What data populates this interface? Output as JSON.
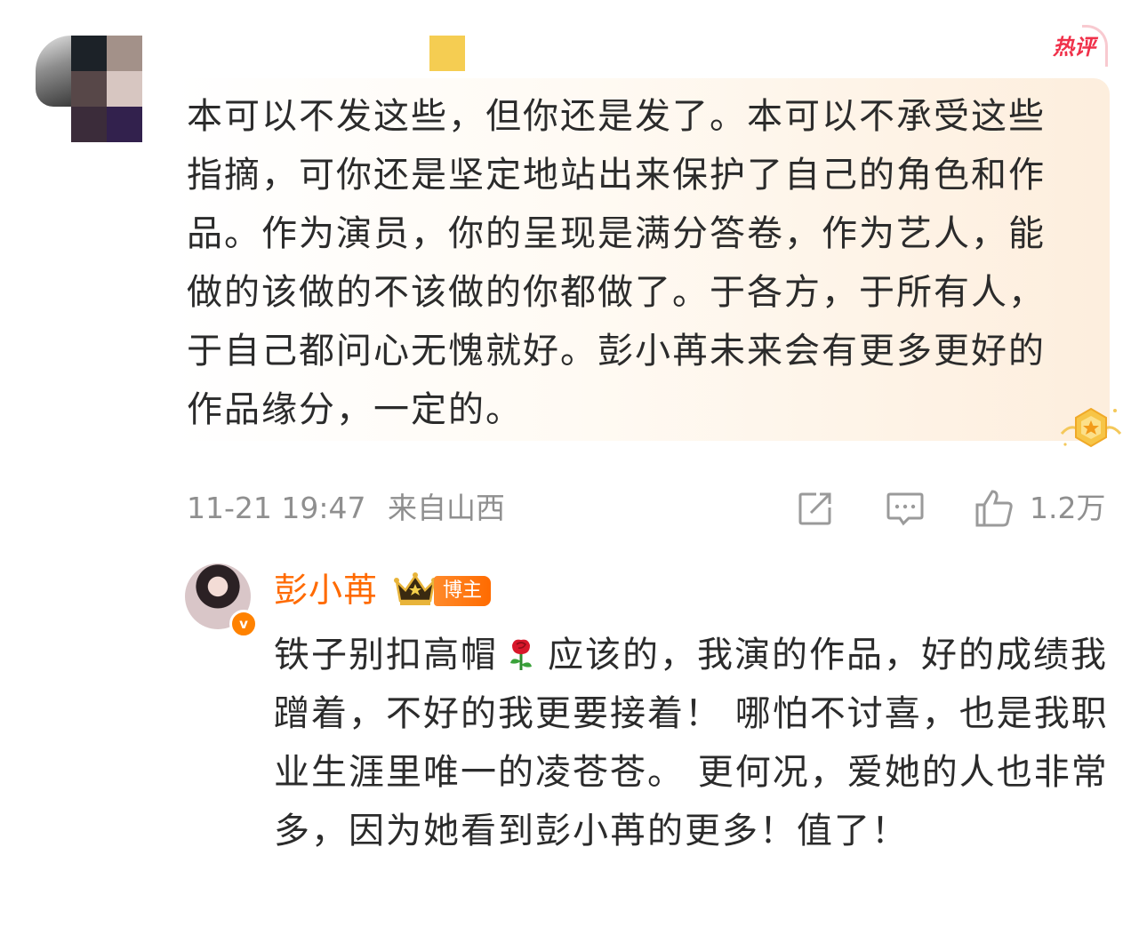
{
  "comment": {
    "hot_label": "热评",
    "text": "本可以不发这些，但你还是发了。本可以不承受这些指摘，可你还是坚定地站出来保护了自己的角色和作品。作为演员，你的呈现是满分答卷，作为艺人，能做的该做的不该做的你都做了。于各方，于所有人，于自己都问心无愧就好。彭小苒未来会有更多更好的作品缘分，一定的。",
    "timestamp": "11-21 19:47",
    "location": "来自山西",
    "like_count": "1.2万"
  },
  "reply": {
    "author": "彭小苒",
    "role_tag": "博主",
    "text_before_emoji": "铁子别扣高帽",
    "emoji": "rose-emoji",
    "text_after_emoji": "应该的，我演的作品，好的成绩我蹭着，不好的我更要接着！ 哪怕不讨喜，也是我职业生涯里唯一的凌苍苍。 更何况，爱她的人也非常多，因为她看到彭小苒的更多！值了！"
  },
  "colors": {
    "accent_orange": "#ff6a00",
    "hot_red": "#f0314a",
    "meta_gray": "#8f8f8f",
    "bubble_peach": "#fdeedd"
  },
  "icons": [
    "repost-icon",
    "comment-icon",
    "like-icon",
    "medal-icon",
    "crown-icon",
    "verified-icon"
  ]
}
